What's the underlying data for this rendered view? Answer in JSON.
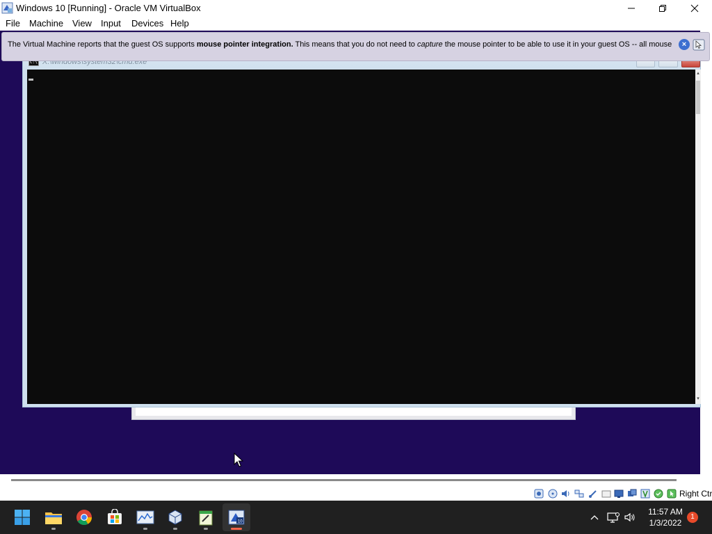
{
  "host_window": {
    "title": "Windows 10 [Running] - Oracle VM VirtualBox",
    "icon": "virtualbox-icon",
    "controls": [
      "minimize-icon",
      "maximize-icon",
      "close-icon"
    ]
  },
  "menubar": {
    "items": [
      "File",
      "Machine",
      "View",
      "Input",
      "Devices",
      "Help"
    ]
  },
  "notification": {
    "text_before": "The Virtual Machine reports that the guest OS supports ",
    "bold": "mouse pointer integration.",
    "text_middle": " This means that you do not need to ",
    "italic": "capture",
    "text_after": " the mouse pointer to be able to use it in your guest OS -- all mouse"
  },
  "cmd_window": {
    "title": "X:\\windows\\system32\\cmd.exe",
    "background": "#0c0c0c"
  },
  "statusbar": {
    "icons": [
      "hard-disk-icon",
      "optical-drive-icon",
      "audio-icon",
      "network-icon",
      "usb-icon",
      "shared-folders-icon",
      "display-icon",
      "recording-icon",
      "cpu-icon",
      "guest-additions-icon",
      "mouse-integration-icon"
    ],
    "host_key": "Right Ctrl"
  },
  "taskbar": {
    "apps": [
      "start-icon",
      "file-explorer-icon",
      "chrome-icon",
      "microsoft-store-icon",
      "task-manager-icon",
      "virtualbox-manager-icon",
      "notepad-icon",
      "virtualbox-vm-icon"
    ],
    "active_app": "virtualbox-vm-icon",
    "tray": [
      "chevron-up-icon",
      "network-icon",
      "volume-icon"
    ],
    "time": "11:57 AM",
    "date": "1/3/2022",
    "notification_count": "1",
    "accent": "#f5654b"
  },
  "colors": {
    "vm_background": "#1e0a58",
    "taskbar": "#202020"
  }
}
